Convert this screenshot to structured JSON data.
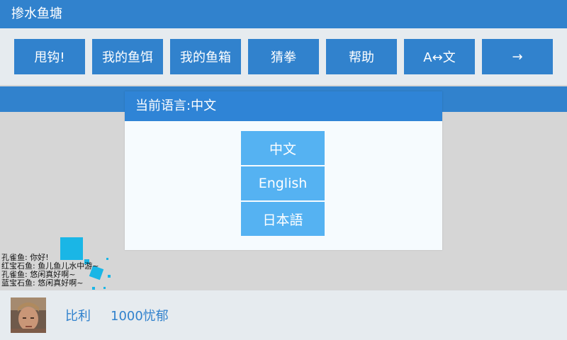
{
  "app": {
    "title": "掺水鱼塘"
  },
  "toolbar": {
    "buttons": [
      {
        "label": "甩钩!"
      },
      {
        "label": "我的鱼饵"
      },
      {
        "label": "我的鱼箱"
      },
      {
        "label": "猜拳"
      },
      {
        "label": "帮助"
      },
      {
        "label": "A↔文"
      },
      {
        "label": "→"
      }
    ]
  },
  "dialog": {
    "title": "当前语言:中文",
    "options": [
      {
        "label": "中文"
      },
      {
        "label": "English"
      },
      {
        "label": "日本語"
      }
    ]
  },
  "chat": {
    "messages": [
      "孔雀鱼: 你好!",
      "红宝石鱼: 鱼儿鱼儿水中游~",
      "孔雀鱼: 悠闲真好啊~",
      "蓝宝石鱼: 悠闲真好啊~"
    ]
  },
  "user": {
    "name": "比利",
    "money": "1000忧郁"
  },
  "colors": {
    "primary": "#3182cd",
    "language_button": "#55b2f2",
    "bar_bg": "#e6ebef",
    "pond_bg": "#d6d6d6"
  }
}
